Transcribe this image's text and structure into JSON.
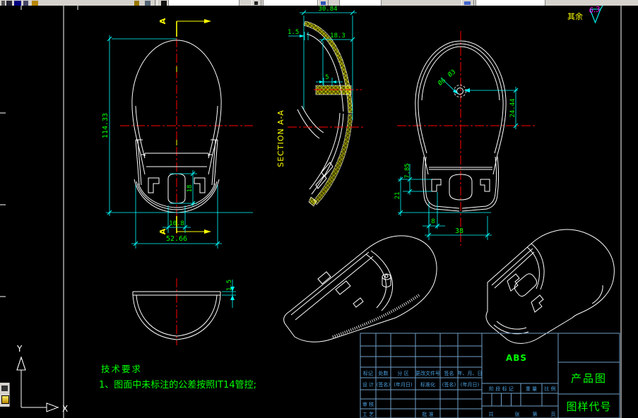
{
  "annotations": {
    "surface_prefix": "其余",
    "surface_roughness": "6.3"
  },
  "section": {
    "title": "SECTION A-A",
    "arrow_label": "A"
  },
  "dims": {
    "top_view": {
      "overall_height": "114.33",
      "slot_height": "18",
      "slot_width": "10.8",
      "overall_width": "52.66"
    },
    "section_view": {
      "depth": "30.84",
      "wall_thickness": "1.5",
      "inner_depth": "18.3",
      "boss_width": "5"
    },
    "bottom_view": {
      "hole_d1": "Ø3",
      "hole_d2": "Ø6",
      "hole_offset": "24.44",
      "tab_height": "7.85",
      "side_height": "21",
      "edge_gap": "8",
      "flat_width": "38"
    },
    "front_view": {
      "rim_thickness": "1.5"
    }
  },
  "tech_req": {
    "title": "技术要求",
    "item_1": "1、图面中未标注的公差按照IT14管控;"
  },
  "ucs": {
    "x_label": "X",
    "y_label": "Y"
  },
  "title_block": {
    "material": "ABS",
    "product_label": "产品图",
    "code_label": "图样代号",
    "row_change": [
      "标记",
      "处数",
      "分 区",
      "更改文件号",
      "签名",
      "年、月、日"
    ],
    "row_design": [
      "设 计",
      "(签名)",
      "(年月日)",
      "标准化",
      "(签名)",
      "(年月日)"
    ],
    "review_label": "审 核",
    "process_label": "工 艺",
    "approve_label": "批 准",
    "stage_label": "阶 段 标 记",
    "weight_label": "重 量",
    "scale_label": "比 例",
    "sheet_labels": [
      "共",
      "张",
      "第",
      "页"
    ]
  },
  "colors": {
    "dimension": "#00ffff",
    "dim_text": "#00ff00",
    "centerline": "#ff0000",
    "geometry": "#ffffff",
    "section": "#ffff00",
    "roughness": "#ff00ff",
    "block_line": "#6f9fc8",
    "block_text": "#4aa0e0",
    "toolbar_bg": "#d6d3ce"
  }
}
